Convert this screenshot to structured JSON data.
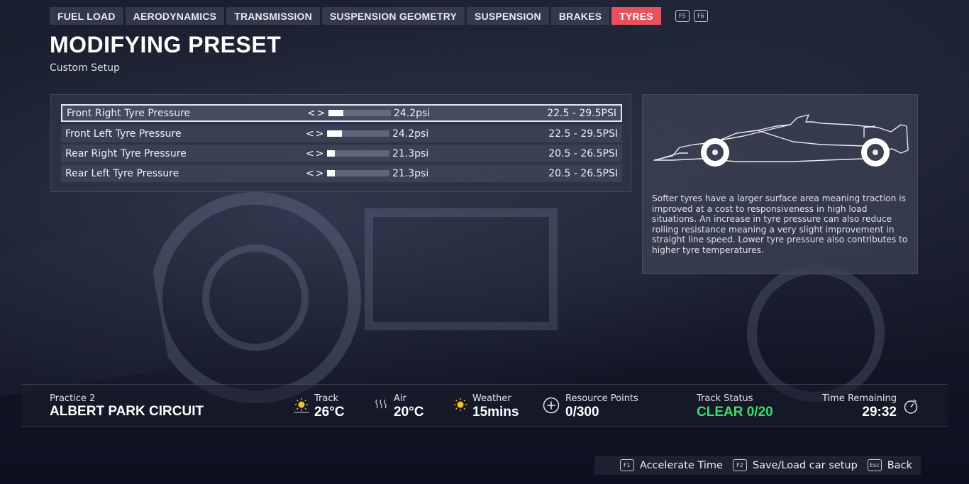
{
  "tabs": [
    {
      "label": "FUEL LOAD"
    },
    {
      "label": "AERODYNAMICS"
    },
    {
      "label": "TRANSMISSION"
    },
    {
      "label": "SUSPENSION GEOMETRY"
    },
    {
      "label": "SUSPENSION"
    },
    {
      "label": "BRAKES"
    },
    {
      "label": "TYRES",
      "active": true
    }
  ],
  "tab_keys": [
    "F5",
    "F6"
  ],
  "page": {
    "title": "MODIFYING PRESET",
    "subtitle": "Custom Setup"
  },
  "settings": [
    {
      "label": "Front Right Tyre Pressure",
      "value": "24.2psi",
      "range": "22.5 - 29.5PSI",
      "level": 0.24,
      "selected": true
    },
    {
      "label": "Front Left Tyre Pressure",
      "value": "24.2psi",
      "range": "22.5 - 29.5PSI",
      "level": 0.24
    },
    {
      "label": "Rear Right Tyre Pressure",
      "value": "21.3psi",
      "range": "20.5 - 26.5PSI",
      "level": 0.13
    },
    {
      "label": "Rear Left Tyre Pressure",
      "value": "21.3psi",
      "range": "20.5 - 26.5PSI",
      "level": 0.13
    }
  ],
  "info": {
    "description": "Softer tyres have a larger surface area meaning traction is improved at a cost to responsiveness in high load situations. An increase in tyre pressure can also reduce rolling resistance meaning a very slight improvement in straight line speed. Lower tyre pressure also contributes to higher tyre temperatures."
  },
  "status": {
    "session": "Practice 2",
    "circuit": "ALBERT PARK CIRCUIT",
    "track": {
      "label": "Track",
      "value": "26°C",
      "icon": "sun-icon"
    },
    "air": {
      "label": "Air",
      "value": "20°C",
      "icon": "heat-waves-icon"
    },
    "weather": {
      "label": "Weather",
      "value": "15mins",
      "icon": "sun-icon"
    },
    "resource_points": {
      "label": "Resource Points",
      "value": "0/300",
      "icon": "plus-circle-icon"
    },
    "track_status": {
      "label": "Track Status",
      "value": "CLEAR 0/20",
      "color": "#3ddc6a"
    },
    "time_remaining": {
      "label": "Time Remaining",
      "value": "29:32",
      "icon": "stopwatch-icon"
    }
  },
  "footer": {
    "accelerate": {
      "key": "F1",
      "label": "Accelerate Time"
    },
    "save_load": {
      "key": "F2",
      "label": "Save/Load car setup"
    },
    "back": {
      "key": "Esc",
      "label": "Back"
    }
  },
  "colors": {
    "accent": "#e8525f",
    "status_green": "#3ddc6a"
  }
}
